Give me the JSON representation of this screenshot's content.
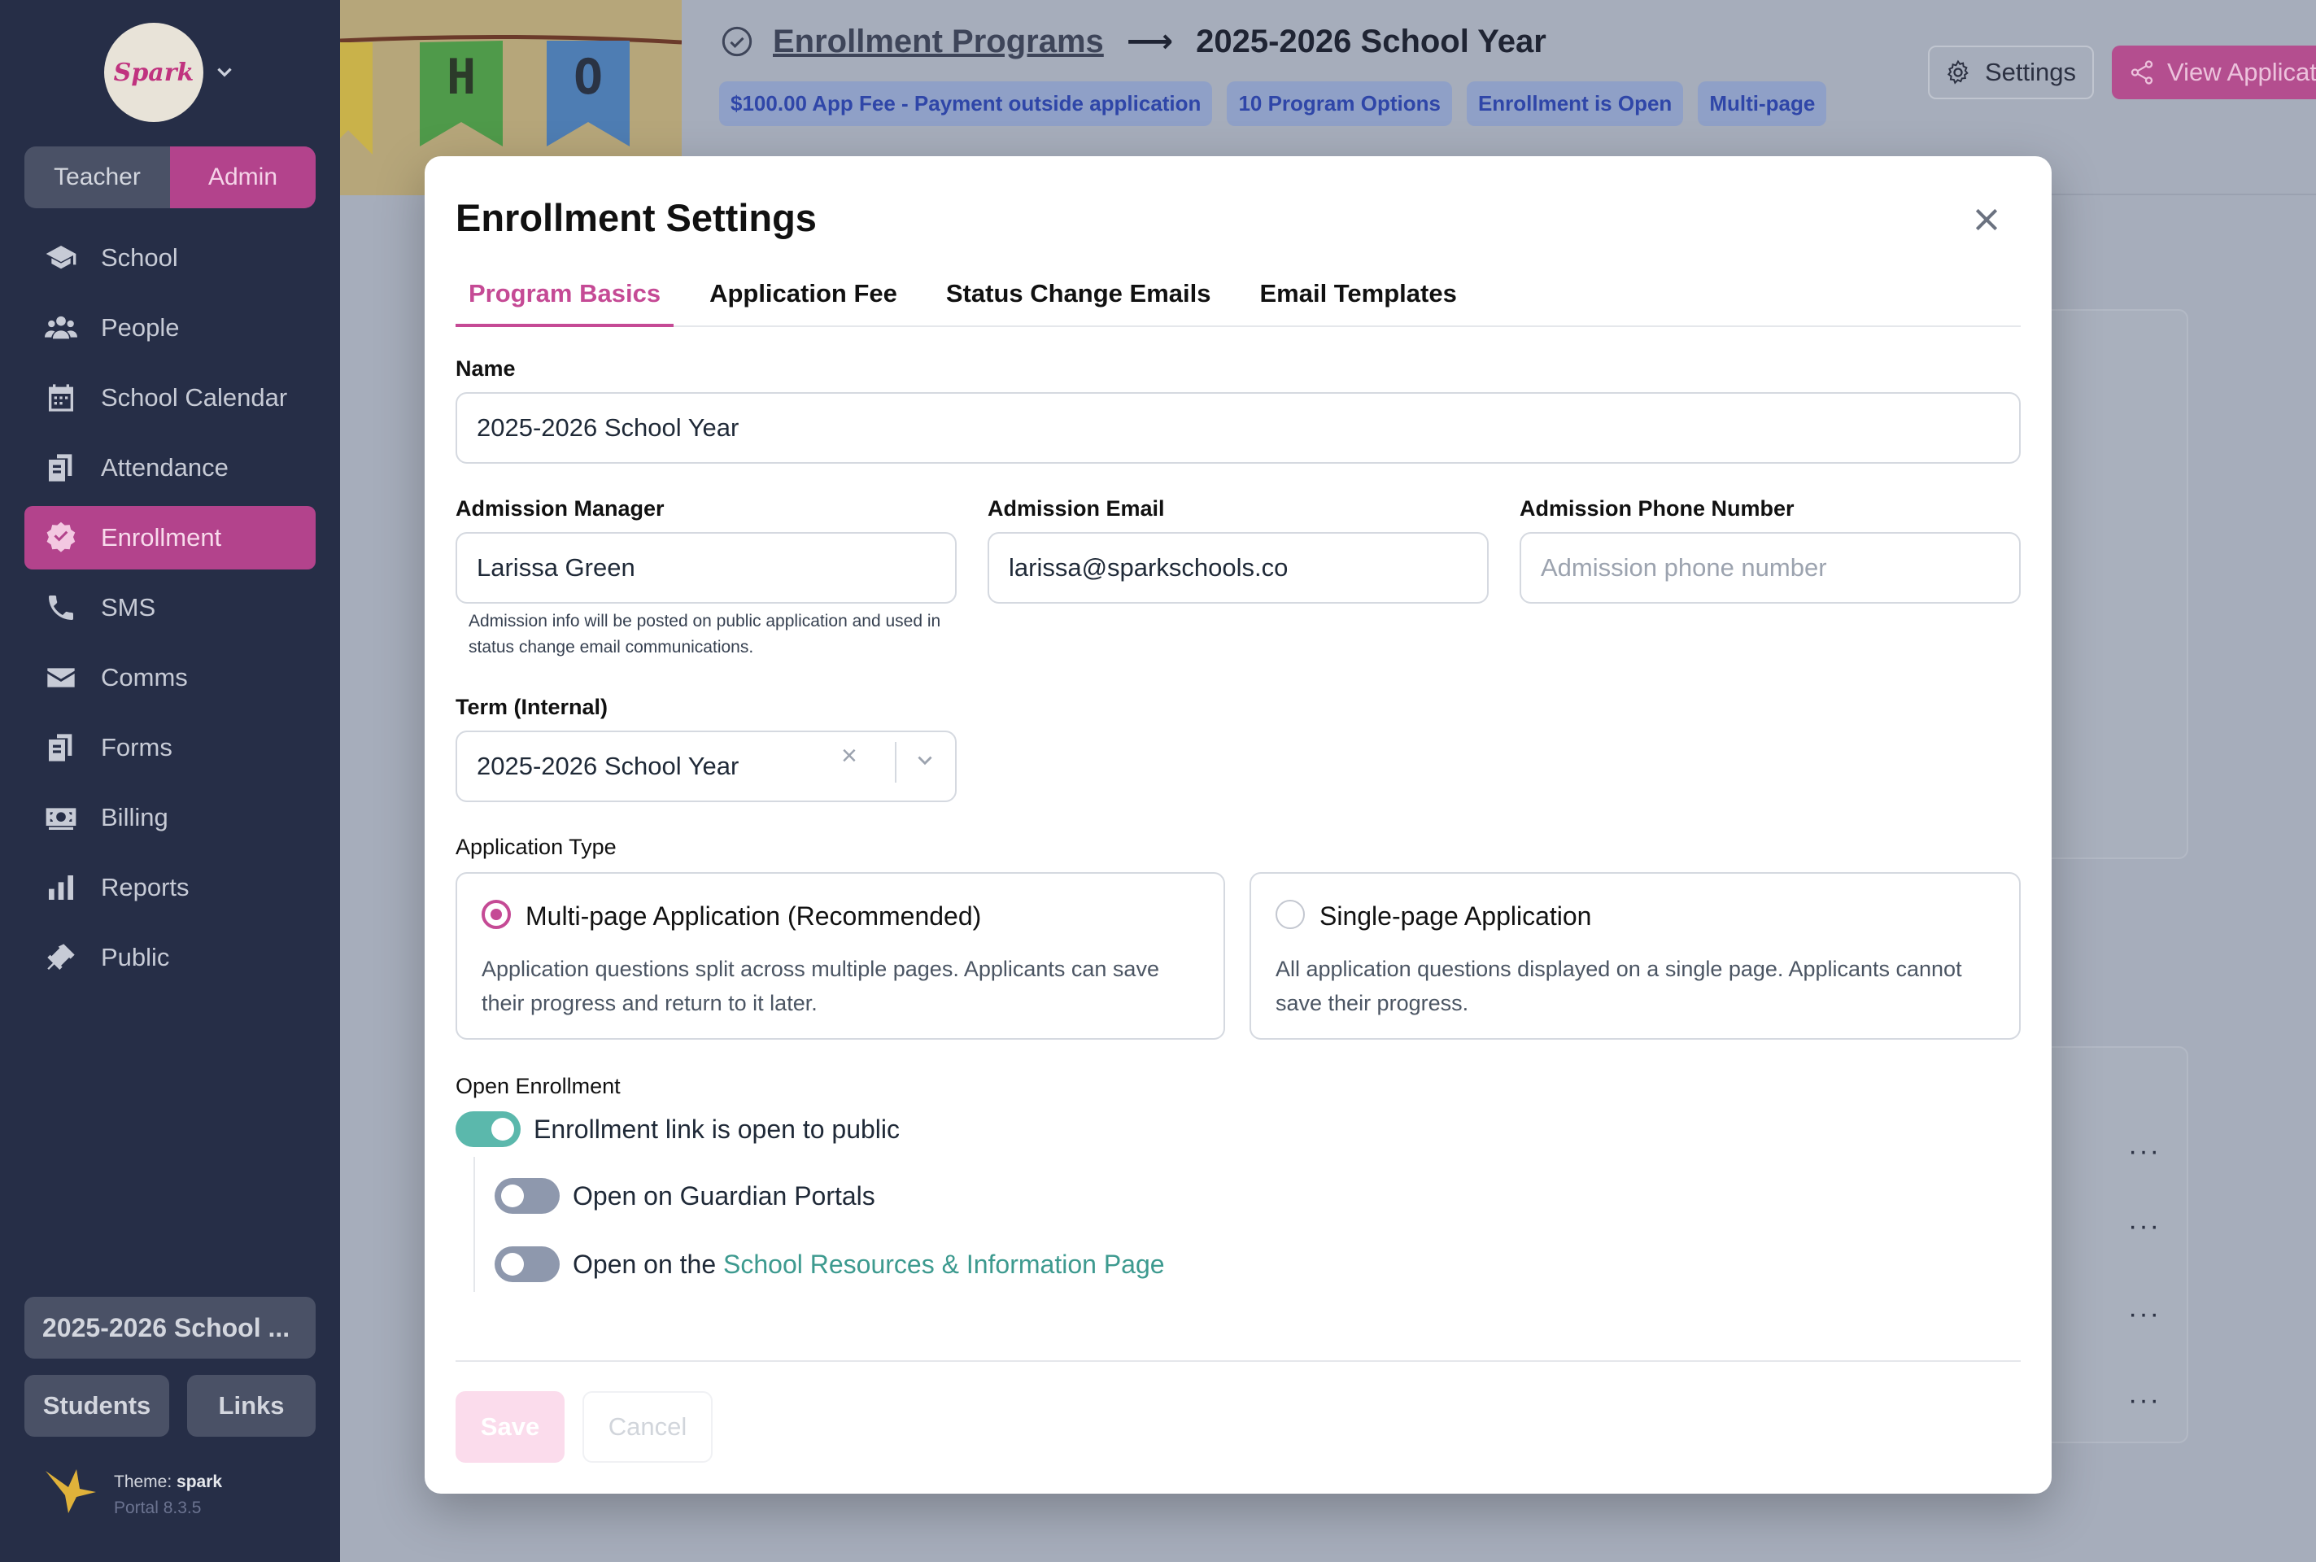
{
  "sidebar": {
    "logo_text": "Spark",
    "roles": [
      {
        "label": "Teacher",
        "active": false
      },
      {
        "label": "Admin",
        "active": true
      }
    ],
    "nav": [
      {
        "label": "School",
        "icon": "school-icon"
      },
      {
        "label": "People",
        "icon": "people-icon"
      },
      {
        "label": "School Calendar",
        "icon": "calendar-icon"
      },
      {
        "label": "Attendance",
        "icon": "attendance-icon"
      },
      {
        "label": "Enrollment",
        "icon": "enrollment-check-icon",
        "active": true
      },
      {
        "label": "SMS",
        "icon": "phone-icon"
      },
      {
        "label": "Comms",
        "icon": "envelope-icon"
      },
      {
        "label": "Forms",
        "icon": "forms-icon"
      },
      {
        "label": "Billing",
        "icon": "money-icon"
      },
      {
        "label": "Reports",
        "icon": "bar-chart-icon"
      },
      {
        "label": "Public",
        "icon": "public-megaphone-icon"
      }
    ],
    "term_button": "2025-2026 School ...",
    "students_button": "Students",
    "links_button": "Links",
    "theme_label": "Theme:",
    "theme_name": "spark",
    "version": "Portal 8.3.5"
  },
  "header": {
    "crumb_parent": "Enrollment Programs",
    "crumb_arrow": "⟶",
    "crumb_current": "2025-2026 School Year",
    "badges": [
      "$100.00 App Fee - Payment outside application",
      "10 Program Options",
      "Enrollment is Open",
      "Multi-page"
    ],
    "settings_button": "Settings",
    "view_button": "View Application",
    "banner_letters": [
      "H",
      "O"
    ]
  },
  "modal": {
    "title": "Enrollment Settings",
    "tabs": [
      "Program Basics",
      "Application Fee",
      "Status Change Emails",
      "Email Templates"
    ],
    "active_tab": "Program Basics",
    "name_label": "Name",
    "name_value": "2025-2026 School Year",
    "manager_label": "Admission Manager",
    "manager_value": "Larissa Green",
    "email_label": "Admission Email",
    "email_value": "larissa@sparkschools.co",
    "phone_label": "Admission Phone Number",
    "phone_placeholder": "Admission phone number",
    "admission_help": "Admission info will be posted on public application and used in status change email communications.",
    "term_label": "Term (Internal)",
    "term_value": "2025-2026 School Year",
    "app_type_label": "Application Type",
    "app_types": [
      {
        "title": "Multi-page Application (Recommended)",
        "desc": "Application questions split across multiple pages. Applicants can save their progress and return to it later.",
        "selected": true
      },
      {
        "title": "Single-page Application",
        "desc": "All application questions displayed on a single page. Applicants cannot save their progress.",
        "selected": false
      }
    ],
    "open_enrollment_label": "Open Enrollment",
    "toggle_public": {
      "label": "Enrollment link is open to public",
      "on": true
    },
    "toggle_guardian": {
      "label": "Open on Guardian Portals",
      "on": false
    },
    "toggle_resources": {
      "label_prefix": "Open on the ",
      "link": "School Resources & Information Page",
      "on": false
    },
    "save_button": "Save",
    "cancel_button": "Cancel"
  },
  "row_menu_glyph": "···",
  "colors": {
    "accent": "#c54a95",
    "toggle_on": "#5bb8ac",
    "sidebar_bg": "#262e47"
  }
}
